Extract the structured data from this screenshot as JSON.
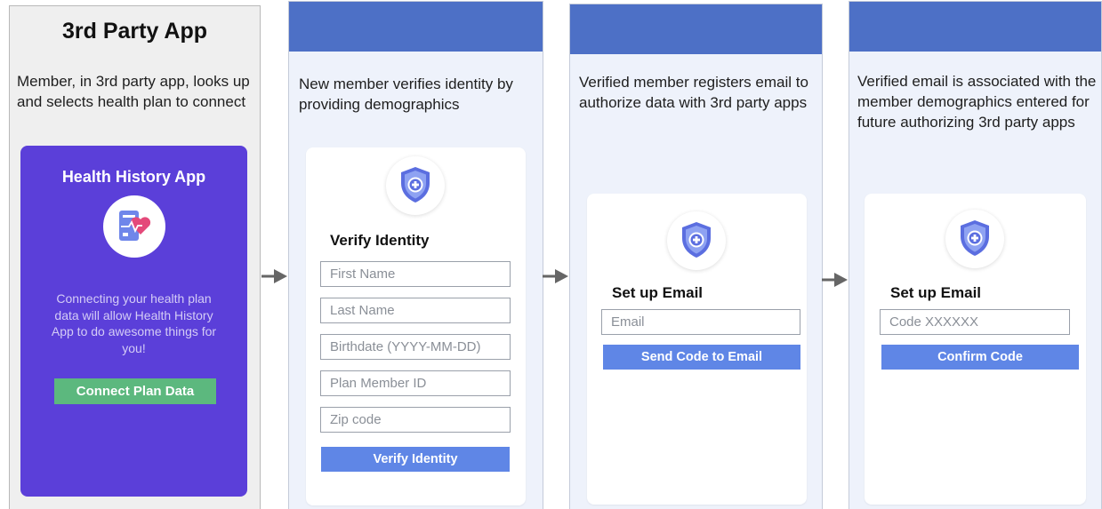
{
  "app_column": {
    "title": "3rd Party App",
    "description": "Member, in 3rd party app, looks up and selects health plan to connect",
    "card": {
      "title": "Health History App",
      "text": "Connecting your health plan data will allow Health History App to do awesome things for you!",
      "button_label": "Connect Plan Data",
      "icon": "health-record-heart-icon"
    }
  },
  "steps": [
    {
      "header": "",
      "description": "New member verifies identity by providing demographics",
      "form_title": "Verify Identity",
      "fields": [
        "First Name",
        "Last Name",
        "Birthdate (YYYY-MM-DD)",
        "Plan Member ID",
        "Zip code"
      ],
      "button_label": "Verify Identity",
      "icon": "shield-plus-icon"
    },
    {
      "header": "",
      "description": "Verified member registers email to authorize data with 3rd party apps",
      "form_title": "Set up Email",
      "fields": [
        "Email"
      ],
      "button_label": "Send Code to Email",
      "icon": "shield-plus-icon"
    },
    {
      "header": "",
      "description": "Verified email is associated with the member demographics entered for future authorizing 3rd party apps",
      "form_title": "Set up Email",
      "fields": [
        "Code XXXXXX"
      ],
      "button_label": "Confirm Code",
      "icon": "shield-plus-icon"
    }
  ],
  "colors": {
    "app_card": "#5b3fd9",
    "connect_button": "#5cb87e",
    "step_header": "#4d70c6",
    "step_background": "#eef2fb",
    "action_button": "#5f86e6",
    "shield": "#5b6ee0",
    "arrow": "#666666"
  }
}
